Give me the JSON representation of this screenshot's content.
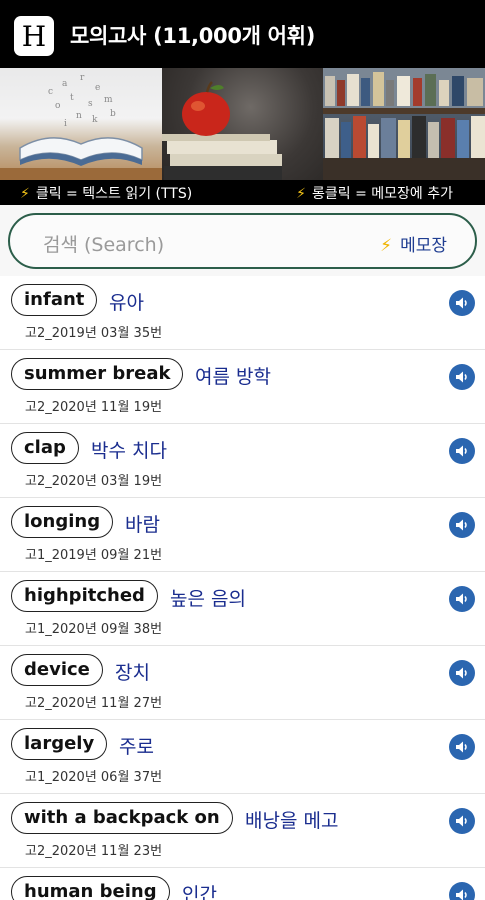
{
  "header": {
    "logo_letter": "H",
    "title": "모의고사 (11,000개 어휘)"
  },
  "banner": {
    "images": [
      "open-book-image",
      "apple-on-books-image",
      "bookshelf-image"
    ],
    "caption_left": "클릭 = 텍스트 읽기 (TTS)",
    "caption_right": "롱클릭 = 메모장에 추가",
    "bolt_icon": "⚡"
  },
  "search": {
    "placeholder": "검색 (Search)",
    "memo_label": "메모장"
  },
  "colors": {
    "accent": "#2c5e4a",
    "meaning": "#1a2d8f",
    "speaker": "#2b66b0"
  },
  "words": [
    {
      "word": "infant",
      "meaning": "유아",
      "source": "고2_2019년 03월 35번"
    },
    {
      "word": "summer break",
      "meaning": "여름 방학",
      "source": "고2_2020년 11월 19번"
    },
    {
      "word": "clap",
      "meaning": "박수 치다",
      "source": "고2_2020년 03월 19번"
    },
    {
      "word": "longing",
      "meaning": "바람",
      "source": "고1_2019년 09월 21번"
    },
    {
      "word": "highpitched",
      "meaning": "높은 음의",
      "source": "고1_2020년 09월 38번"
    },
    {
      "word": "device",
      "meaning": "장치",
      "source": "고2_2020년 11월 27번"
    },
    {
      "word": "largely",
      "meaning": "주로",
      "source": "고1_2020년 06월 37번"
    },
    {
      "word": "with a backpack on",
      "meaning": "배낭을 메고",
      "source": "고2_2020년 11월 23번"
    },
    {
      "word": "human being",
      "meaning": "인간",
      "source": ""
    }
  ]
}
